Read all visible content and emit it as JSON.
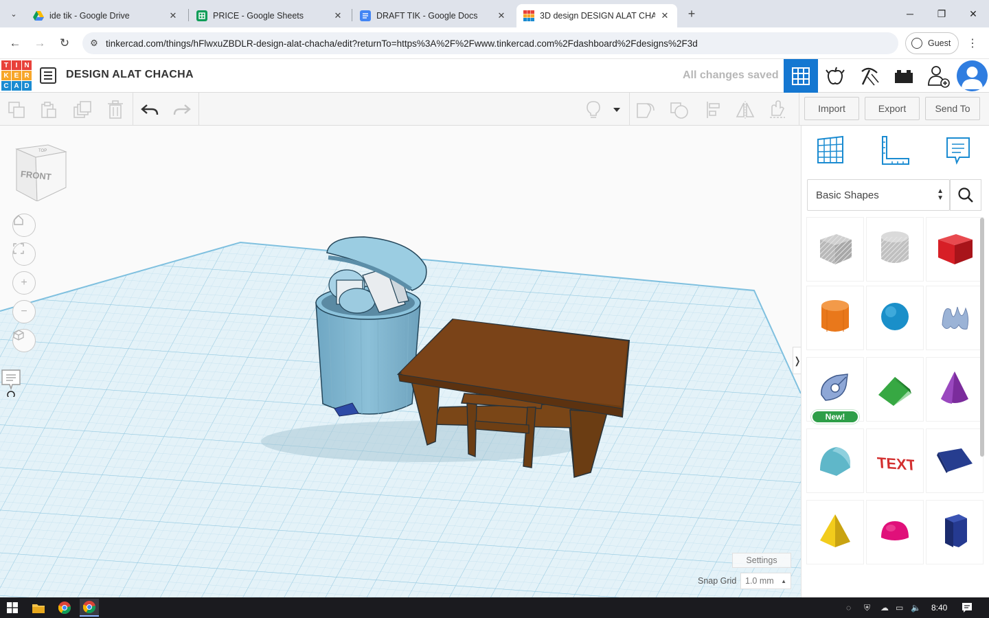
{
  "browser": {
    "tabs": [
      {
        "title": "ide tik - Google Drive",
        "active": false
      },
      {
        "title": "PRICE - Google Sheets",
        "active": false
      },
      {
        "title": "DRAFT TIK - Google Docs",
        "active": false
      },
      {
        "title": "3D design DESIGN ALAT CHACHA | Tinkercad",
        "active": true
      }
    ],
    "url": "tinkercad.com/things/hFlwxuZBDLR-design-alat-chacha/edit?returnTo=https%3A%2F%2Fwww.tinkercad.com%2Fdashboard%2Fdesigns%2F3d",
    "profile_label": "Guest"
  },
  "app": {
    "logo_letters": [
      "T",
      "I",
      "N",
      "K",
      "E",
      "R",
      "C",
      "A",
      "D"
    ],
    "logo_colors": [
      "#e8413a",
      "#e8413a",
      "#e8413a",
      "#f7a629",
      "#f7a629",
      "#f7a629",
      "#1a8bd1",
      "#1a8bd1",
      "#1a8bd1"
    ],
    "design_title": "DESIGN ALAT CHACHA",
    "save_status": "All changes saved",
    "accent": "#1477d1"
  },
  "toolbar": {
    "import_label": "Import",
    "export_label": "Export",
    "send_to_label": "Send To"
  },
  "viewport": {
    "viewcube_front": "FRONT",
    "viewcube_top": "TOP",
    "settings_label": "Settings",
    "snap_grid_label": "Snap Grid",
    "snap_grid_value": "1.0 mm"
  },
  "panel": {
    "library": "Basic Shapes",
    "new_badge": "New!",
    "shapes": [
      {
        "name": "box-hole",
        "color": "#b8b8b8"
      },
      {
        "name": "cylinder-hole",
        "color": "#c0c0c0"
      },
      {
        "name": "box",
        "color": "#d71f26"
      },
      {
        "name": "cylinder",
        "color": "#e9781b"
      },
      {
        "name": "sphere",
        "color": "#1a8fc9"
      },
      {
        "name": "scribble",
        "color": "#9bb3d6"
      },
      {
        "name": "shape-generator",
        "color": "#8ea7d6",
        "badge": true
      },
      {
        "name": "roof",
        "color": "#2e9b3a"
      },
      {
        "name": "cone",
        "color": "#7b2c9c"
      },
      {
        "name": "round-roof",
        "color": "#5fb7c9"
      },
      {
        "name": "text",
        "color": "#d32f2f"
      },
      {
        "name": "wedge",
        "color": "#263d8f"
      },
      {
        "name": "pyramid",
        "color": "#f2cc1c"
      },
      {
        "name": "half-sphere",
        "color": "#e0107a"
      },
      {
        "name": "polygon",
        "color": "#253a91"
      }
    ]
  },
  "taskbar": {
    "time": "8:40"
  }
}
